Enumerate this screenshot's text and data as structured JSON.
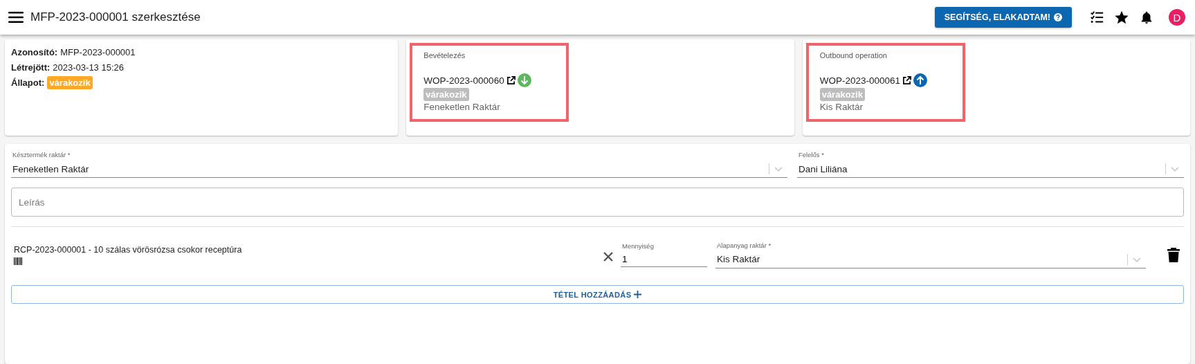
{
  "header": {
    "title": "MFP-2023-000001 szerkesztése",
    "help_button": {
      "label": "SEGÍTSÉG, ELAKADTAM!"
    },
    "avatar": {
      "initial": "D"
    }
  },
  "summary": [
    {
      "label": "Azonosító:",
      "value": "MFP-2023-000001",
      "kind": "text"
    },
    {
      "label": "Létrejött:",
      "value": "2023-03-13 15:26",
      "kind": "text"
    },
    {
      "label": "Állapot:",
      "value": "várakozik",
      "kind": "badge",
      "color": "#ffa726"
    }
  ],
  "operations": [
    {
      "heading": "Bevételezés",
      "number": "WOP-2023-000060",
      "kind": "inbound",
      "status": "várakozik",
      "color": "#bdbdbd",
      "warehouse": "Feneketlen Raktár",
      "highlighted": true
    },
    {
      "heading": "Outbound operation",
      "number": "WOP-2023-000061",
      "kind": "outbound",
      "status": "várakozik",
      "color": "#bdbdbd",
      "warehouse": "Kis Raktár",
      "highlighted": true
    }
  ],
  "form": {
    "fields": [
      {
        "label": "Késztermék raktár *",
        "value": "Feneketlen Raktár"
      },
      {
        "label": "Felelős *",
        "value": "Dani Liliána"
      }
    ],
    "description": {
      "placeholder": "Leírás"
    },
    "items": [
      {
        "title": "RCP-2023-000001 - 10 szálas vörösrózsa csokor receptúra",
        "quantity_label": "Mennyiség",
        "quantity": "1",
        "warehouse_label": "Alapanyag raktár *",
        "warehouse": "Kis Raktár"
      }
    ],
    "add_button": {
      "label": "TÉTEL HOZZÁADÁS"
    }
  }
}
